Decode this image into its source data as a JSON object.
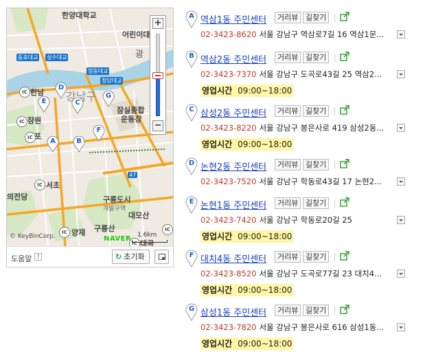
{
  "map": {
    "labels": {
      "l1": "한양대학교",
      "l2": "어린이대",
      "l3": "광",
      "l4": "동호대교",
      "l5": "성수대교",
      "l6": "영동대교",
      "l7": "청담대교",
      "l8": "한남",
      "l9": "잠원",
      "l10": "반포",
      "l11": "잠실종합",
      "l12": "운동장",
      "l13": "서초",
      "l14": "의전당",
      "l15": "구룡도시",
      "l16": "개발구역",
      "l17": "대모산",
      "l18": "구룡산",
      "l19": "양재",
      "l20": "대곡",
      "l21": "강남구",
      "road47": "47"
    },
    "ic_badge": "IC",
    "scale": "1.6km",
    "copyright": "© KeyBinCorp.",
    "logo": "NAVER",
    "zoom_in": "+",
    "zoom_out": "−",
    "pins": [
      "A",
      "B",
      "C",
      "D",
      "E",
      "F",
      "G"
    ],
    "footer": {
      "help": "도움말",
      "help_q": "?",
      "reset": "초기화"
    }
  },
  "entries": [
    {
      "letter": "A",
      "name": "역삼1동 주민센터",
      "review": "거리뷰",
      "directions": "길찾기",
      "phone": "02-3423-8620",
      "address": "서울 강남구 역삼로7길 16 역삼1문...",
      "hours_label": "",
      "hours": ""
    },
    {
      "letter": "B",
      "name": "역삼2동 주민센터",
      "review": "거리뷰",
      "directions": "길찾기",
      "phone": "02-3423-7370",
      "address": "서울 강남구 도곡로43길 25 역삼2...",
      "hours_label": "영업시간",
      "hours": "09:00~18:00"
    },
    {
      "letter": "C",
      "name": "삼성2동 주민센터",
      "review": "거리뷰",
      "directions": "길찾기",
      "phone": "02-3423-8220",
      "address": "서울 강남구 봉은사로 419 삼성2동...",
      "hours_label": "영업시간",
      "hours": "09:00~18:00"
    },
    {
      "letter": "D",
      "name": "논현2동 주민센터",
      "review": "거리뷰",
      "directions": "길찾기",
      "phone": "02-3423-7520",
      "address": "서울 강남구 학동로43길 17 논현2...",
      "hours_label": "",
      "hours": ""
    },
    {
      "letter": "E",
      "name": "논현1동 주민센터",
      "review": "거리뷰",
      "directions": "길찾기",
      "phone": "02-3423-7420",
      "address": "서울 강남구 학동로20길 25",
      "hours_label": "영업시간",
      "hours": "09:00~18:00"
    },
    {
      "letter": "F",
      "name": "대치4동 주민센터",
      "review": "거리뷰",
      "directions": "길찾기",
      "phone": "02-3423-8520",
      "address": "서울 강남구 도곡로77길 23 대치4...",
      "hours_label": "영업시간",
      "hours": "09:00~18:00"
    },
    {
      "letter": "G",
      "name": "삼성1동 주민센터",
      "review": "거리뷰",
      "directions": "길찾기",
      "phone": "02-3423-7820",
      "address": "서울 강남구 봉은사로 616 삼성1동...",
      "hours_label": "영업시간",
      "hours": "09:00~18:00"
    }
  ],
  "colors": {
    "link": "#1a3fbf",
    "phone": "#c0392b",
    "hours_bg": "#fff7a6",
    "river": "#aad3e6",
    "road_major": "#f5a623"
  }
}
